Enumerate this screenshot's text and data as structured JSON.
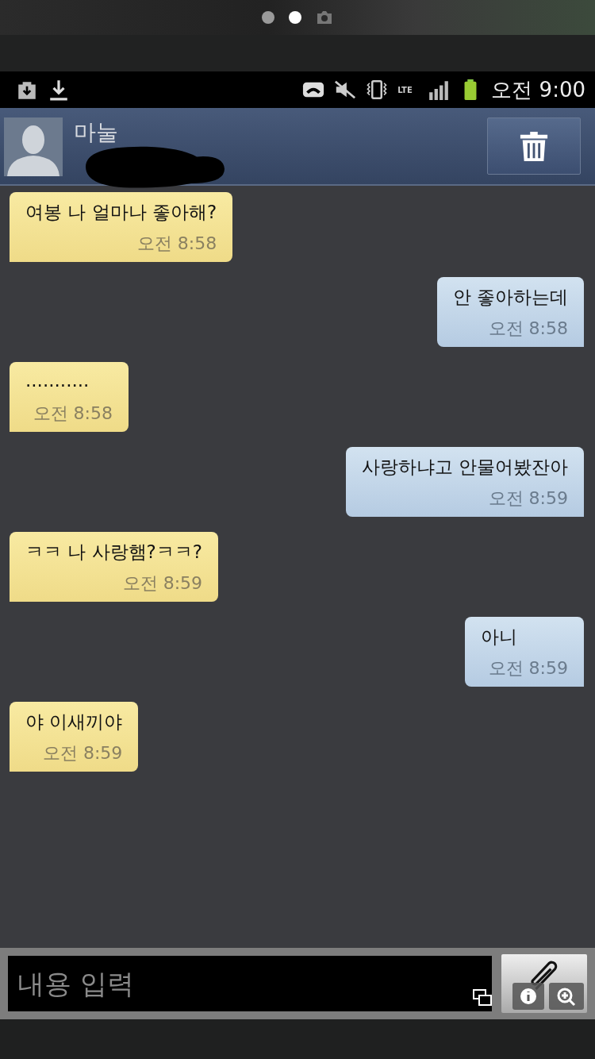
{
  "viewer": {
    "pages": [
      {
        "selected": false
      },
      {
        "selected": true
      }
    ]
  },
  "status_bar": {
    "network": "LTE",
    "time": "오전 9:00"
  },
  "header": {
    "contact_name": "마눌"
  },
  "messages": [
    {
      "kind": "received",
      "text": "여봉 나 얼마나 좋아해?",
      "time": "오전 8:58"
    },
    {
      "kind": "sent",
      "text": "안 좋아하는데",
      "time": "오전 8:58"
    },
    {
      "kind": "received",
      "text": "...........",
      "time": "오전 8:58"
    },
    {
      "kind": "sent",
      "text": "사랑하냐고 안물어봤잔아",
      "time": "오전 8:59"
    },
    {
      "kind": "received",
      "text": "ㅋㅋ 나 사랑햄?ㅋㅋ?",
      "time": "오전 8:59"
    },
    {
      "kind": "sent",
      "text": "아니",
      "time": "오전 8:59"
    },
    {
      "kind": "received",
      "text": "야 이새끼야",
      "time": "오전 8:59"
    }
  ],
  "composer": {
    "placeholder": "내용 입력"
  }
}
